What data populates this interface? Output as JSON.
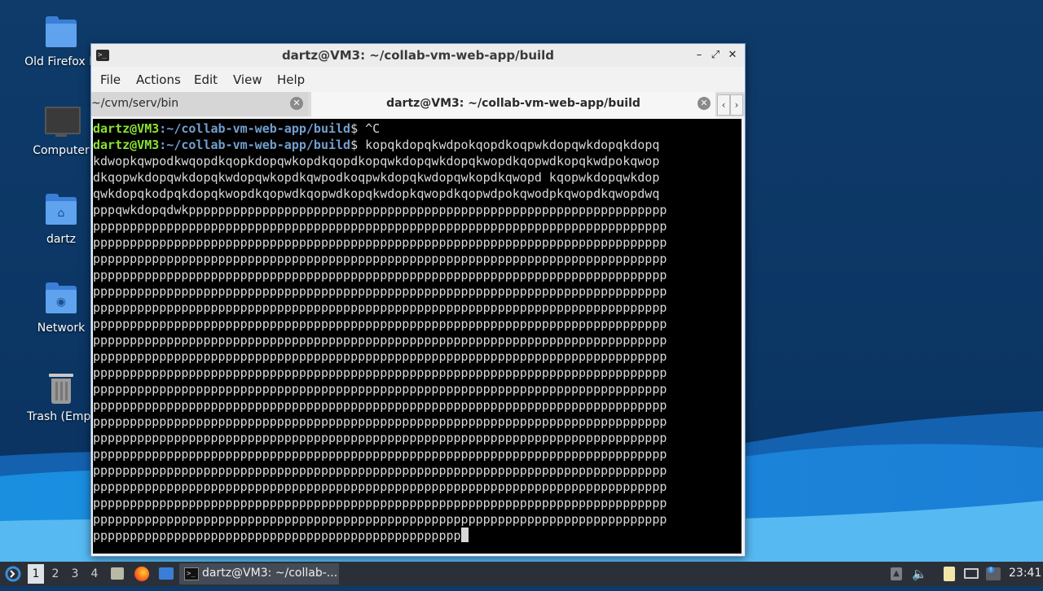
{
  "desktop": {
    "icons": [
      {
        "label": "Old Firefox D",
        "icon": "folder-icon"
      },
      {
        "label": "Computer",
        "icon": "computer-icon"
      },
      {
        "label": "dartz",
        "icon": "home-folder-icon"
      },
      {
        "label": "Network",
        "icon": "network-folder-icon"
      },
      {
        "label": "Trash (Empt",
        "icon": "trash-icon"
      }
    ]
  },
  "window": {
    "title": "dartz@VM3: ~/collab-vm-web-app/build",
    "menu": [
      "File",
      "Actions",
      "Edit",
      "View",
      "Help"
    ],
    "tabs": [
      {
        "label": "~/cvm/serv/bin",
        "active": false
      },
      {
        "label": "dartz@VM3: ~/collab-vm-web-app/build",
        "active": true
      }
    ],
    "terminal": {
      "prompt_user": "dartz@VM3",
      "prompt_path": ":~/collab-vm-web-app/build",
      "prompt_symbol": "$ ",
      "line1_cmd": "^C",
      "line2_cmd": "kopqkdopqkwdpokqopdkoqpwkdopqwkdopqkdopq",
      "output": [
        "kdwopkqwpodkwqopdkqopkdopqwkopdkqopdkopqwkdopqwkdopqkwopdkqopwdkopqkwdpokqwop",
        "dkqopwkdopqwkdopqkwdopqwkopdkqwpodkoqpwkdopqkwdopqwkopdkqwopd kqopwkdopqwkdop",
        "qwkdopqkodpqkdopqkwopdkqopwdkqopwdkopqkwdopkqwopdkqopwdpokqwodpkqwopdkqwopdwq",
        "pppqwkdopqdwkppppppppppppppppppppppppppppppppppppppppppppppppppppppppppppppppp",
        "pppppppppppppppppppppppppppppppppppppppppppppppppppppppppppppppppppppppppppppp",
        "pppppppppppppppppppppppppppppppppppppppppppppppppppppppppppppppppppppppppppppp",
        "pppppppppppppppppppppppppppppppppppppppppppppppppppppppppppppppppppppppppppppp",
        "pppppppppppppppppppppppppppppppppppppppppppppppppppppppppppppppppppppppppppppp",
        "pppppppppppppppppppppppppppppppppppppppppppppppppppppppppppppppppppppppppppppp",
        "pppppppppppppppppppppppppppppppppppppppppppppppppppppppppppppppppppppppppppppp",
        "pppppppppppppppppppppppppppppppppppppppppppppppppppppppppppppppppppppppppppppp",
        "pppppppppppppppppppppppppppppppppppppppppppppppppppppppppppppppppppppppppppppp",
        "pppppppppppppppppppppppppppppppppppppppppppppppppppppppppppppppppppppppppppppp",
        "pppppppppppppppppppppppppppppppppppppppppppppppppppppppppppppppppppppppppppppp",
        "pppppppppppppppppppppppppppppppppppppppppppppppppppppppppppppppppppppppppppppp",
        "pppppppppppppppppppppppppppppppppppppppppppppppppppppppppppppppppppppppppppppp",
        "pppppppppppppppppppppppppppppppppppppppppppppppppppppppppppppppppppppppppppppp",
        "pppppppppppppppppppppppppppppppppppppppppppppppppppppppppppppppppppppppppppppp",
        "pppppppppppppppppppppppppppppppppppppppppppppppppppppppppppppppppppppppppppppp",
        "pppppppppppppppppppppppppppppppppppppppppppppppppppppppppppppppppppppppppppppp",
        "pppppppppppppppppppppppppppppppppppppppppppppppppppppppppppppppppppppppppppppp",
        "pppppppppppppppppppppppppppppppppppppppppppppppppppppppppppppppppppppppppppppp",
        "pppppppppppppppppppppppppppppppppppppppppppppppppppppppppppppppppppppppppppppp",
        "pppppppppppppppppppppppppppppppppppppppppppppppppp"
      ]
    }
  },
  "taskbar": {
    "workspaces": [
      "1",
      "2",
      "3",
      "4"
    ],
    "active_workspace": "1",
    "task_label": "dartz@VM3: ~/collab-...",
    "clock": "23:41",
    "colors": {
      "bar": "#2b3038",
      "accent": "#3b7ed8"
    }
  }
}
